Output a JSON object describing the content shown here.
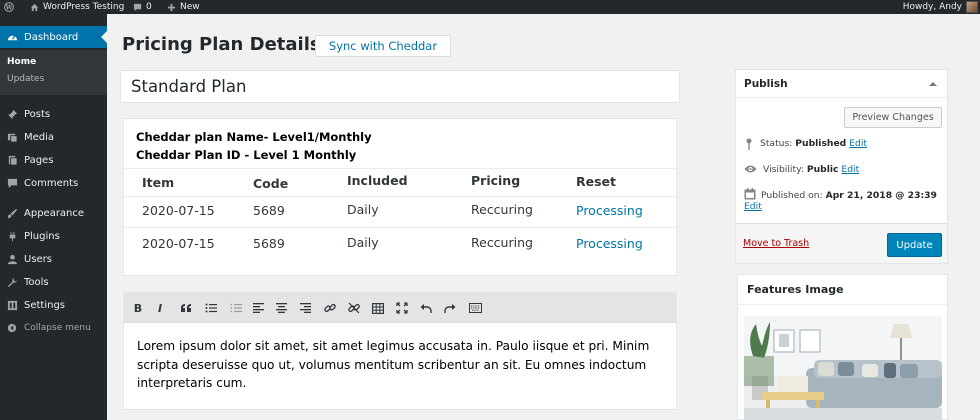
{
  "admin_bar": {
    "site_name": "WordPress Testing",
    "comments_count": "0",
    "new_label": "New",
    "greeting": "Howdy, Andy"
  },
  "sidebar": {
    "dashboard_label": "Dashboard",
    "submenu": [
      "Home",
      "Updates"
    ],
    "items": [
      {
        "label": "Posts",
        "icon": "pin-icon"
      },
      {
        "label": "Media",
        "icon": "media-icon"
      },
      {
        "label": "Pages",
        "icon": "pages-icon"
      },
      {
        "label": "Comments",
        "icon": "comment-icon"
      },
      {
        "label": "Appearance",
        "icon": "brush-icon"
      },
      {
        "label": "Plugins",
        "icon": "plug-icon"
      },
      {
        "label": "Users",
        "icon": "user-icon"
      },
      {
        "label": "Tools",
        "icon": "wrench-icon"
      },
      {
        "label": "Settings",
        "icon": "settings-icon"
      }
    ],
    "collapse_label": "Collapse menu"
  },
  "main": {
    "page_title": "Pricing Plan Details",
    "sync_button": "Sync with Cheddar",
    "title_value": "Standard Plan",
    "plan": {
      "name_line": "Cheddar plan Name- Level1/Monthly",
      "id_line": "Cheddar Plan ID - Level 1 Monthly",
      "headers": [
        "Item",
        "Code",
        "Included",
        "Pricing",
        "Reset"
      ],
      "rows": [
        [
          "2020-07-15",
          "5689",
          "Daily",
          "Reccuring",
          "Processing"
        ],
        [
          "2020-07-15",
          "5689",
          "Daily",
          "Reccuring",
          "Processing"
        ]
      ]
    },
    "editor": {
      "toolbar": [
        "B",
        "I",
        "quote",
        "bulleted-list",
        "numbered-list",
        "align-left",
        "align-center",
        "align-right",
        "link",
        "unlink",
        "table",
        "fullscreen",
        "undo",
        "redo",
        "keyboard"
      ],
      "content": "Lorem ipsum dolor sit amet, sit amet legimus accusata in. Paulo iisque et pri. Minim scripta deseruisse quo ut, volumus mentitum scribentur an sit. Eu omnes indoctum interpretaris cum."
    }
  },
  "publish": {
    "title": "Publish",
    "preview_button": "Preview Changes",
    "status_label": "Status:",
    "status_value": "Published",
    "visibility_label": "Visibility:",
    "visibility_value": "Public",
    "published_label": "Published on:",
    "published_value": "Apr 21, 2018 @ 23:39",
    "edit_link": "Edit",
    "trash_link": "Move to Trash",
    "update_button": "Update"
  },
  "features": {
    "title": "Features Image"
  },
  "colors": {
    "admin_dark": "#23282d",
    "accent": "#0073aa",
    "primary_button": "#0085ba",
    "trash_red": "#a00"
  }
}
